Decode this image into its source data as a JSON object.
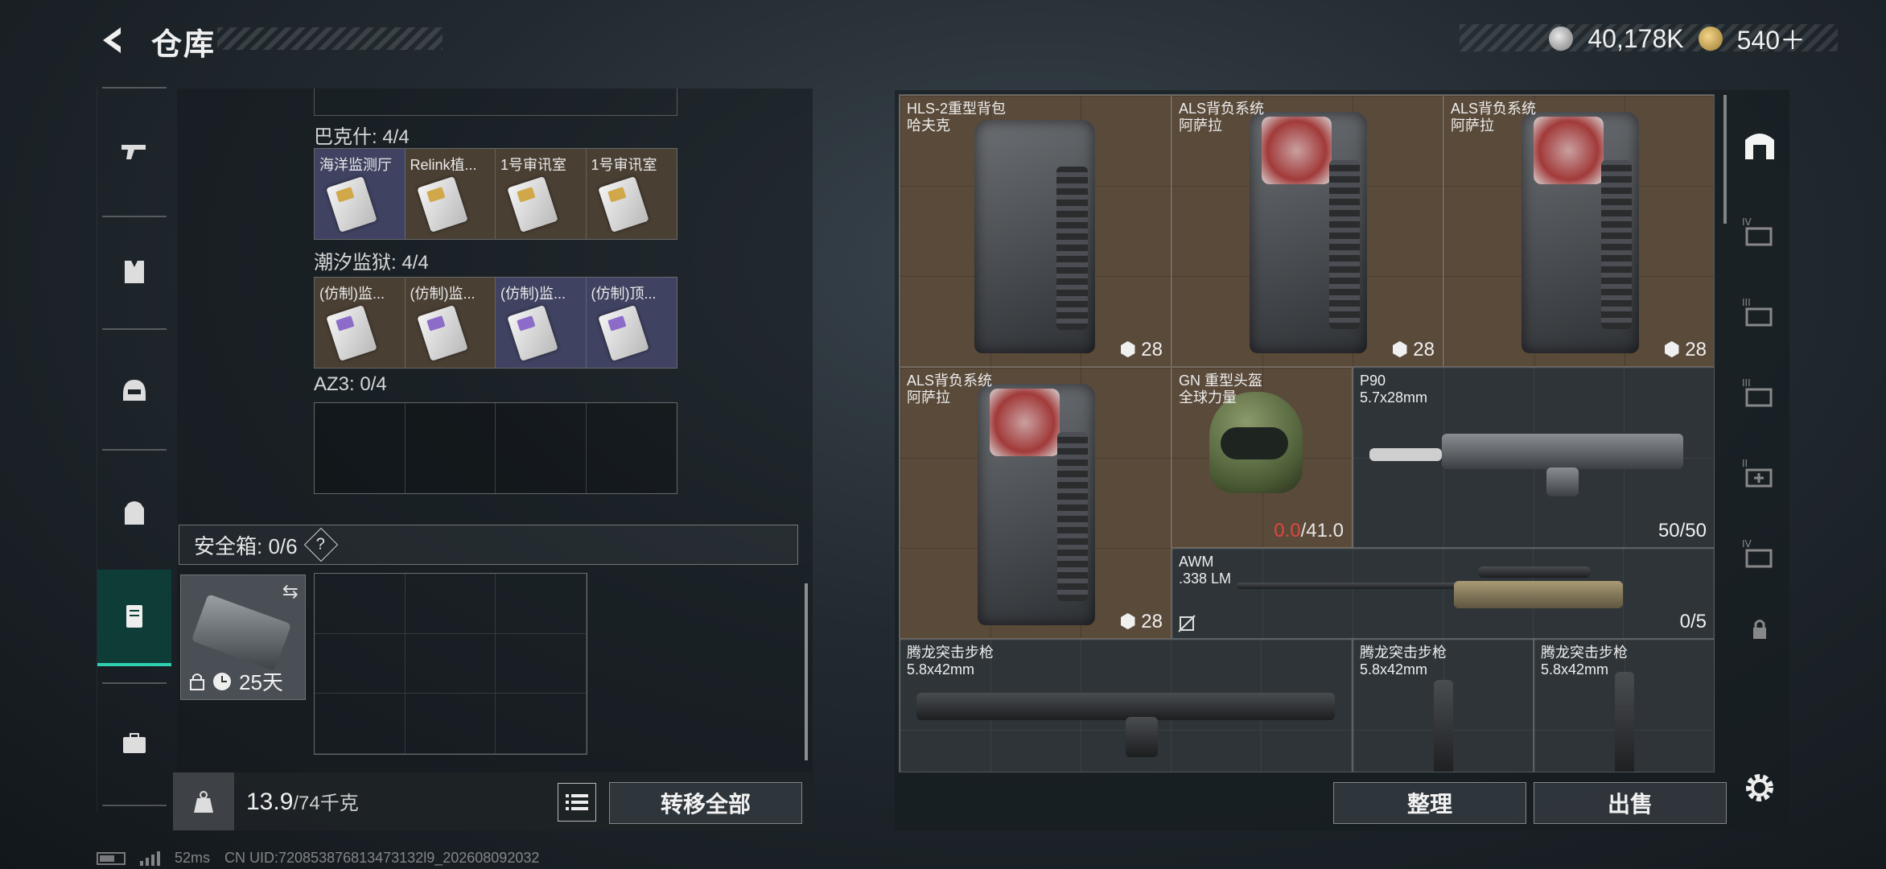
{
  "header": {
    "title": "仓库",
    "currency_silver": "40,178K",
    "currency_gold": "540＋"
  },
  "left_nav": {
    "items": [
      {
        "id": "weapons",
        "icon": "gun-icon"
      },
      {
        "id": "armor",
        "icon": "vest-icon"
      },
      {
        "id": "helmet",
        "icon": "helmet-icon"
      },
      {
        "id": "backpack",
        "icon": "backpack-icon"
      },
      {
        "id": "storage",
        "icon": "locker-icon",
        "active": true
      },
      {
        "id": "briefcase",
        "icon": "briefcase-icon"
      }
    ]
  },
  "collections": {
    "bakeshi": {
      "label": "巴克什: 4/4",
      "cells": [
        "海洋监测厅",
        "Relink植...",
        "1号审讯室",
        "1号审讯室"
      ]
    },
    "chaoxi": {
      "label": "潮汐监狱: 4/4",
      "cells": [
        "(仿制)监...",
        "(仿制)监...",
        "(仿制)监...",
        "(仿制)顶..."
      ]
    },
    "az3": {
      "label": "AZ3: 0/4"
    }
  },
  "safe_box": {
    "label": "安全箱: 0/6",
    "help": "?",
    "timer": "25天"
  },
  "weight": {
    "current": "13.9",
    "max": "/74千克"
  },
  "buttons": {
    "transfer_all": "转移全部",
    "arrange": "整理",
    "sell": "出售"
  },
  "inventory": [
    {
      "name": "HLS-2重型背包",
      "sub": "哈夫克",
      "count": "28"
    },
    {
      "name": "ALS背负系统",
      "sub": "阿萨拉",
      "count": "28"
    },
    {
      "name": "ALS背负系统",
      "sub": "阿萨拉",
      "count": "28"
    },
    {
      "name": "ALS背负系统",
      "sub": "阿萨拉",
      "count": "28"
    },
    {
      "name": "GN 重型头盔",
      "sub": "全球力量",
      "durability_current": "0.0",
      "durability_max": "/41.0"
    },
    {
      "name": "P90",
      "sub": "5.7x28mm",
      "count": "50/50"
    },
    {
      "name": "AWM",
      "sub": ".338 LM",
      "count": "0/5"
    },
    {
      "name": "腾龙突击步枪",
      "sub": "5.8x42mm"
    },
    {
      "name": "腾龙突击步枪",
      "sub": "5.8x42mm"
    },
    {
      "name": "腾龙突击步枪",
      "sub": "5.8x42mm"
    }
  ],
  "footer": {
    "ping": "52ms",
    "uid": "CN UID:720853876813473132l9_202608092032"
  }
}
